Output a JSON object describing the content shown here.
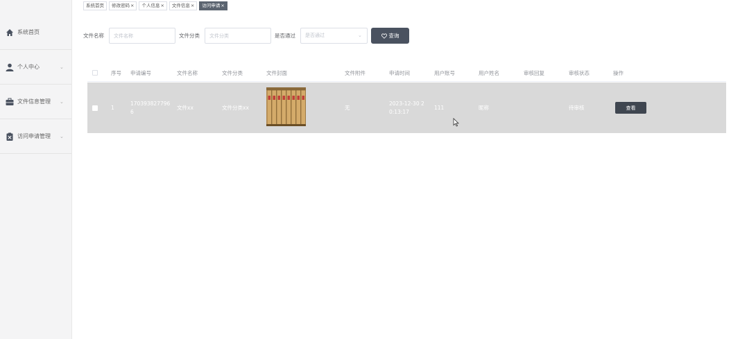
{
  "sidebar": {
    "items": [
      {
        "label": "系统首页",
        "icon": "home-icon",
        "has_arrow": false
      },
      {
        "label": "个人中心",
        "icon": "user-icon",
        "has_arrow": true
      },
      {
        "label": "文件信息管理",
        "icon": "briefcase-icon",
        "has_arrow": true
      },
      {
        "label": "访问申请管理",
        "icon": "clipboard-icon",
        "has_arrow": true
      }
    ],
    "arrow_glyph": "⌄"
  },
  "tabs": [
    {
      "label": "系统首页",
      "closable": false,
      "active": false
    },
    {
      "label": "修改密码",
      "closable": true,
      "active": false
    },
    {
      "label": "个人信息",
      "closable": true,
      "active": false
    },
    {
      "label": "文件信息",
      "closable": true,
      "active": false
    },
    {
      "label": "访问申请",
      "closable": true,
      "active": true
    }
  ],
  "tab_close_glyph": "×",
  "search": {
    "file_name_label": "文件名称",
    "file_name_placeholder": "文件名称",
    "file_category_label": "文件分类",
    "file_category_placeholder": "文件分类",
    "approved_label": "是否通过",
    "approved_placeholder": "是否通过",
    "query_button": "查询"
  },
  "table": {
    "headers": [
      "序号",
      "申请编号",
      "文件名称",
      "文件分类",
      "文件封面",
      "文件附件",
      "申请时间",
      "用户账号",
      "用户姓名",
      "审核回复",
      "审核状态",
      "操作"
    ],
    "rows": [
      {
        "index": "1",
        "apply_no_line1": "170393827796",
        "apply_no_line2": "6",
        "file_name": "文件xx",
        "file_category": "文件分类xx",
        "attachment": "无",
        "apply_time_line1": "2023-12-30 2",
        "apply_time_line2": "0:13:17",
        "user_account": "111",
        "user_name": "昵称",
        "review_reply": "",
        "review_status": "待审核",
        "action": "查看"
      }
    ]
  },
  "colors": {
    "active_tab": "#5b6470",
    "button": "#4a5260",
    "row_highlight": "#d9d9d9"
  }
}
